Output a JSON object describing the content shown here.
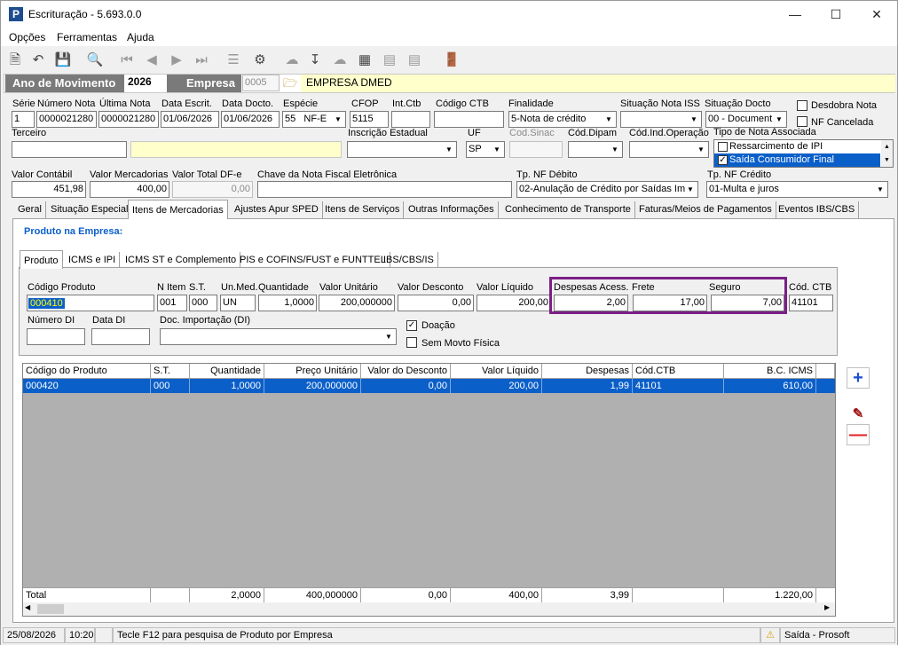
{
  "window": {
    "title": "Escrituração - 5.693.0.0",
    "icon_letter": "P"
  },
  "menu": [
    "Opções",
    "Ferramentas",
    "Ajuda"
  ],
  "header": {
    "ano_label": "Ano de Movimento",
    "ano_value": "2026",
    "empresa_label": "Empresa",
    "empresa_code": "0005",
    "empresa_name": "EMPRESA DMED"
  },
  "doc": {
    "serie_label": "Série",
    "serie": "1",
    "numero_label": "Número Nota",
    "numero": "0000021280",
    "ultima_label": "Última Nota",
    "ultima": "0000021280",
    "data_escrit_label": "Data Escrit.",
    "data_escrit": "01/06/2026",
    "data_docto_label": "Data Docto.",
    "data_docto": "01/06/2026",
    "especie_label": "Espécie",
    "especie_code": "55",
    "especie": "NF-E",
    "cfop_label": "CFOP",
    "cfop": "5115",
    "intctb_label": "Int.Ctb",
    "intctb": "",
    "codctb_label": "Código CTB",
    "codctb": "",
    "finalidade_label": "Finalidade",
    "finalidade": "5-Nota de crédito",
    "sit_iss_label": "Situação Nota ISS",
    "sit_iss": "",
    "sit_docto_label": "Situação Docto",
    "sit_docto": "00 - Document",
    "desdobra_label": "Desdobra Nota",
    "cancelada_label": "NF Cancelada",
    "terceiro_label": "Terceiro",
    "terceiro": "",
    "ie_label": "Inscrição Estadual",
    "ie": "",
    "uf_label": "UF",
    "uf": "SP",
    "sinac_label": "Cod.Sinac",
    "dipam_label": "Cód.Dipam",
    "indop_label": "Cód.Ind.Operação",
    "tipo_assoc_label": "Tipo de Nota Associada",
    "tipo_assoc_items": [
      "Ressarcimento de IPI",
      "Saída Consumidor Final"
    ],
    "valor_contabil_label": "Valor Contábil",
    "valor_contabil": "451,98",
    "valor_merc_label": "Valor Mercadorias",
    "valor_merc": "400,00",
    "valor_dfe_label": "Valor Total DF-e",
    "valor_dfe": "0,00",
    "chave_label": "Chave da Nota Fiscal Eletrônica",
    "chave": "",
    "tp_debito_label": "Tp. NF Débito",
    "tp_debito": "02-Anulação de Crédito por Saídas Im",
    "tp_credito_label": "Tp. NF Crédito",
    "tp_credito": "01-Multa e juros"
  },
  "main_tabs": [
    "Geral",
    "Situação Especial",
    "Itens de Mercadorias",
    "Ajustes Apur SPED",
    "Itens de Serviços",
    "Outras Informações",
    "Conhecimento de Transporte",
    "Faturas/Meios de Pagamentos",
    "Eventos IBS/CBS"
  ],
  "produto_title": "Produto na Empresa:",
  "sub_tabs": [
    "Produto",
    "ICMS e IPI",
    "ICMS ST e Complemento",
    "PIS e COFINS/FUST e FUNTTEL",
    "IBS/CBS/IS"
  ],
  "item": {
    "cod_label": "Código Produto",
    "cod": "000410",
    "nitem_label": "N Item",
    "nitem": "001",
    "st_label": "S.T.",
    "st": "000",
    "un_label": "Un.Med.",
    "un": "UN",
    "qtd_label": "Quantidade",
    "qtd": "1,0000",
    "vunit_label": "Valor Unitário",
    "vunit": "200,000000",
    "vdesc_label": "Valor Desconto",
    "vdesc": "0,00",
    "vliq_label": "Valor Líquido",
    "vliq": "200,00",
    "desp_label": "Despesas Acess.",
    "desp": "2,00",
    "frete_label": "Frete",
    "frete": "17,00",
    "seguro_label": "Seguro",
    "seguro": "7,00",
    "codctb_label": "Cód. CTB",
    "codctb": "41101",
    "numdi_label": "Número DI",
    "numdi": "",
    "datadi_label": "Data DI",
    "datadi": "",
    "docimp_label": "Doc. Importação (DI)",
    "docimp": "",
    "doacao_label": "Doação",
    "semmovto_label": "Sem Movto Física"
  },
  "grid": {
    "headers": [
      "Código do Produto",
      "S.T.",
      "Quantidade",
      "Preço Unitário",
      "Valor do Desconto",
      "Valor Líquido",
      "Despesas",
      "Cód.CTB",
      "B.C. ICMS"
    ],
    "rows": [
      [
        "000420",
        "000",
        "1,0000",
        "200,000000",
        "0,00",
        "200,00",
        "1,99",
        "41101",
        "610,00"
      ]
    ],
    "total": [
      "Total",
      "",
      "2,0000",
      "400,000000",
      "0,00",
      "400,00",
      "3,99",
      "",
      "1.220,00"
    ]
  },
  "status": {
    "date": "25/08/2026",
    "time": "10:20",
    "hint": "Tecle F12 para pesquisa de Produto por Empresa",
    "mode": "Saída - Prosoft"
  },
  "colors": {
    "accent": "#0b5fc9",
    "highlight_border": "#7b1f86",
    "yellow": "#ffff00"
  }
}
